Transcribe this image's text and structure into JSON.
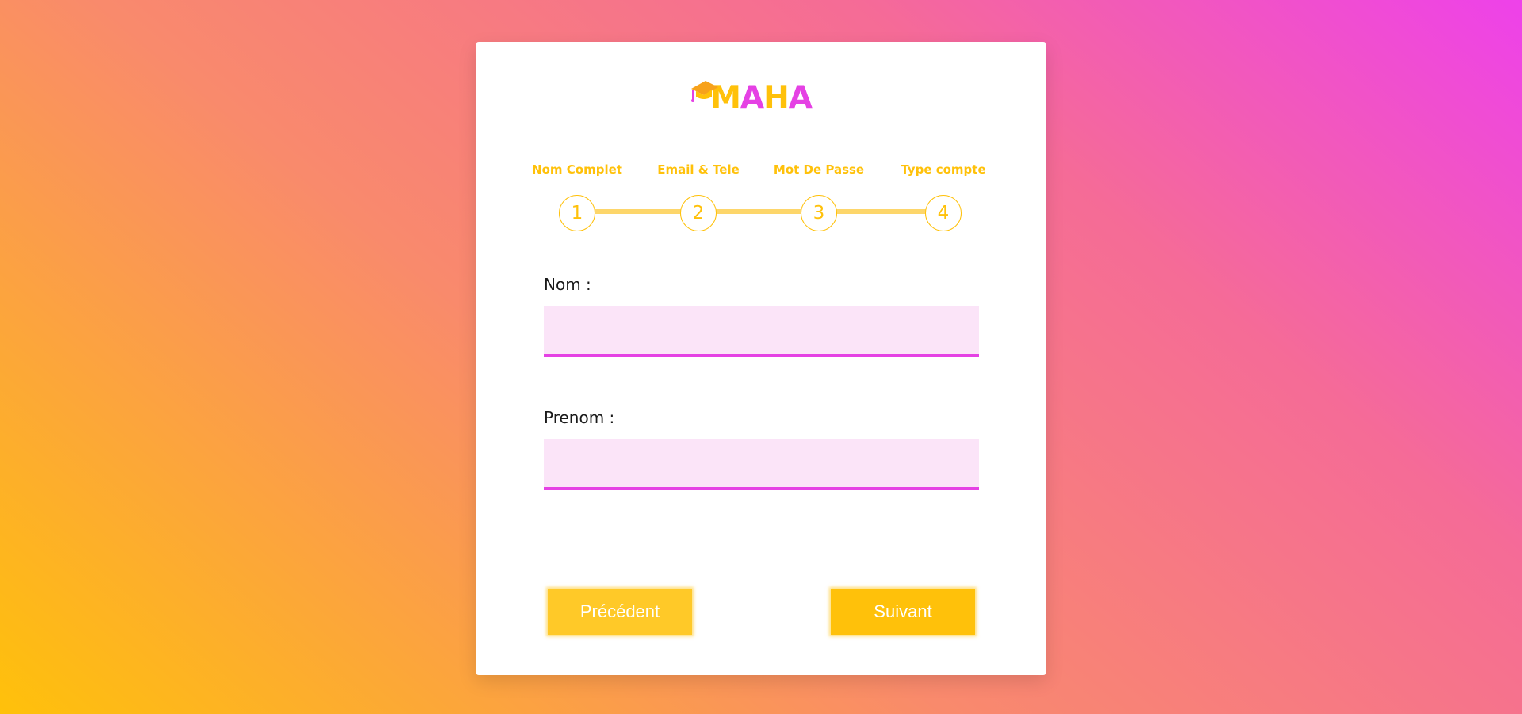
{
  "logo": {
    "letters": [
      {
        "char": "M",
        "color": "#ffc10a"
      },
      {
        "char": "A",
        "color": "#e541e4"
      },
      {
        "char": "H",
        "color": "#ffc10a"
      },
      {
        "char": "A",
        "color": "#e541e4"
      }
    ]
  },
  "steps": [
    {
      "label": "Nom Complet",
      "number": "1"
    },
    {
      "label": "Email & Tele",
      "number": "2"
    },
    {
      "label": "Mot De Passe",
      "number": "3"
    },
    {
      "label": "Type compte",
      "number": "4"
    }
  ],
  "form": {
    "nom_label": "Nom :",
    "nom_value": "",
    "prenom_label": "Prenom :",
    "prenom_value": ""
  },
  "buttons": {
    "prev_label": "Précédent",
    "next_label": "Suivant"
  },
  "colors": {
    "accent_yellow": "#ffc10a",
    "accent_magenta": "#e541e4",
    "input_bg": "#fbe4f8"
  }
}
